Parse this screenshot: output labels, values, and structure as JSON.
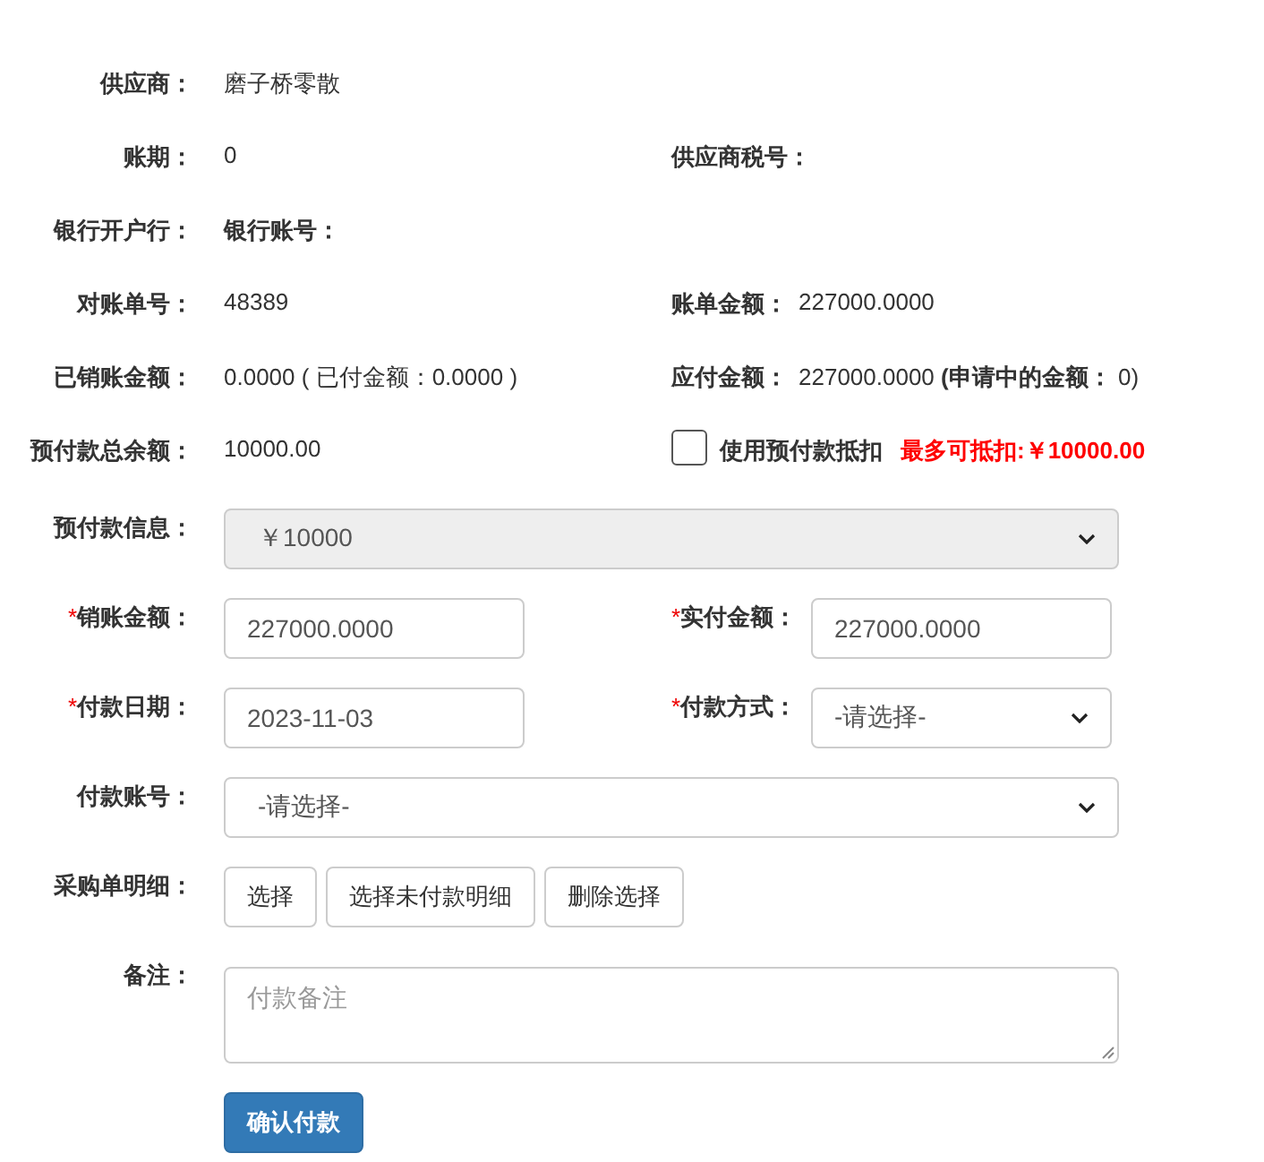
{
  "info_rows": [
    {
      "left": {
        "label": "供应商：",
        "value": "磨子桥零散",
        "kind": "text"
      }
    },
    {
      "left": {
        "label": "账期：",
        "value": "0",
        "kind": "text"
      },
      "right": {
        "label": "供应商税号：",
        "kind": "text"
      }
    },
    {
      "left": {
        "label": "银行开户行：",
        "value": "银行账号：",
        "kind": "label"
      }
    },
    {
      "left": {
        "label": "对账单号：",
        "value": "48389",
        "kind": "text"
      },
      "right": {
        "label": "账单金额：",
        "value": "227000.0000",
        "kind": "text"
      }
    },
    {
      "left": {
        "label": "已销账金额：",
        "value": "0.0000 ( 已付金额：0.0000 )",
        "kind": "text"
      },
      "right": {
        "label": "应付金额：",
        "value": "227000.0000 **(申请中的金额：** 0)",
        "kind": "text"
      }
    },
    {
      "left": {
        "label": "预付款总余额：",
        "value": "10000.00",
        "kind": "text"
      },
      "right": {
        "kind": "checkbox",
        "checked": false,
        "label": "使用预付款抵扣",
        "note": "最多可抵扣:￥10000.00"
      }
    }
  ],
  "form_rows": [
    {
      "fields": [
        {
          "kind": "select",
          "label": "预付款信息：",
          "value": "￥10000",
          "disabled": true,
          "wide": true
        }
      ]
    },
    {
      "fields": [
        {
          "kind": "input",
          "label": "销账金额：",
          "required_mark": "*",
          "value": "227000.0000"
        },
        {
          "kind": "input",
          "label": "实付金额：",
          "required_mark": "*",
          "value": "227000.0000"
        }
      ]
    },
    {
      "fields": [
        {
          "kind": "input",
          "label": "付款日期：",
          "required_mark": "*",
          "value": "2023-11-03"
        },
        {
          "kind": "select",
          "label": "付款方式：",
          "required_mark": "*",
          "value": "-请选择-",
          "disabled": false
        }
      ]
    },
    {
      "fields": [
        {
          "kind": "select",
          "label": "付款账号：",
          "value": "-请选择-",
          "disabled": false,
          "wide": true
        }
      ]
    },
    {
      "fields": [
        {
          "kind": "buttons",
          "label": "采购单明细：",
          "buttons": [
            "选择",
            "选择未付款明细",
            "删除选择"
          ]
        }
      ]
    },
    {
      "fields": [
        {
          "kind": "textarea",
          "label": "备注：",
          "placeholder": "付款备注"
        }
      ]
    }
  ],
  "submit": "确认付款"
}
